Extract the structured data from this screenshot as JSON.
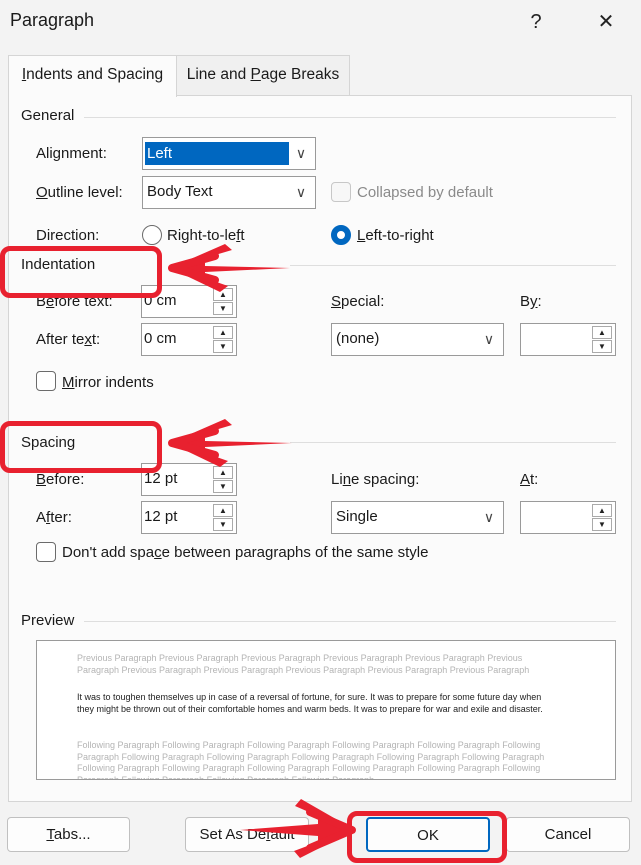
{
  "window": {
    "title": "Paragraph",
    "help_glyph": "?",
    "close_glyph": "✕"
  },
  "tabs": [
    {
      "label_pre": "",
      "label_ul": "I",
      "label_post": "ndents and Spacing",
      "active": true
    },
    {
      "label_pre": "Line and ",
      "label_ul": "P",
      "label_post": "age Breaks",
      "active": false
    }
  ],
  "general": {
    "heading": "General",
    "alignment": {
      "label_pre": "Ali",
      "label_ul": "g",
      "label_post": "nment:",
      "value": "Left"
    },
    "outline": {
      "label_pre": "",
      "label_ul": "O",
      "label_post": "utline level:",
      "value": "Body Text"
    },
    "collapsed_label": "Collapsed by default",
    "direction": {
      "label": "Direction:",
      "rtl_pre": "Right-to-le",
      "rtl_ul": "f",
      "rtl_post": "t",
      "ltr_pre": "",
      "ltr_ul": "L",
      "ltr_post": "eft-to-right",
      "selected": "ltr"
    }
  },
  "indentation": {
    "heading": "Indentation",
    "before_text": {
      "label_pre": "B",
      "label_ul": "e",
      "label_post": "fore text:",
      "value": "0 cm"
    },
    "after_text": {
      "label_pre": "After te",
      "label_ul": "x",
      "label_post": "t:",
      "value": "0 cm"
    },
    "special": {
      "label_pre": "",
      "label_ul": "S",
      "label_post": "pecial:",
      "value": "(none)"
    },
    "by": {
      "label_pre": "B",
      "label_ul": "y",
      "label_post": ":",
      "value": ""
    },
    "mirror": {
      "label_pre": "",
      "label_ul": "M",
      "label_post": "irror indents",
      "checked": false
    }
  },
  "spacing": {
    "heading": "Spacing",
    "before": {
      "label_pre": "",
      "label_ul": "B",
      "label_post": "efore:",
      "value": "12 pt"
    },
    "after": {
      "label_pre": "A",
      "label_ul": "f",
      "label_post": "ter:",
      "value": "12 pt"
    },
    "line_spacing": {
      "label_pre": "Li",
      "label_ul": "n",
      "label_post": "e spacing:",
      "value": "Single"
    },
    "at": {
      "label_pre": "",
      "label_ul": "A",
      "label_post": "t:",
      "value": ""
    },
    "dont_add": {
      "label_pre": "Don't add spa",
      "label_ul": "c",
      "label_post": "e between paragraphs of the same style",
      "checked": false
    }
  },
  "preview": {
    "heading": "Preview",
    "previous": "Previous Paragraph Previous Paragraph Previous Paragraph Previous Paragraph Previous Paragraph Previous Paragraph Previous Paragraph Previous Paragraph Previous Paragraph Previous Paragraph Previous Paragraph",
    "sample": "It was to toughen themselves up in case of a reversal of fortune, for sure. It was to prepare for some future day when they might be thrown out of their comfortable homes and warm beds. It was to prepare for war and exile and disaster.",
    "following": "Following Paragraph Following Paragraph Following Paragraph Following Paragraph Following Paragraph Following Paragraph Following Paragraph Following Paragraph Following Paragraph Following Paragraph Following Paragraph Following Paragraph Following Paragraph Following Paragraph Following Paragraph Following Paragraph Following Paragraph Following Paragraph Following Paragraph Following Paragraph"
  },
  "buttons": {
    "tabs": {
      "pre": "",
      "ul": "T",
      "post": "abs..."
    },
    "default": {
      "pre": "Set As De",
      "ul": "f",
      "post": "ault"
    },
    "ok": "OK",
    "cancel": "Cancel"
  },
  "annotation_color": "#e8212f",
  "accent_color": "#0067c0"
}
